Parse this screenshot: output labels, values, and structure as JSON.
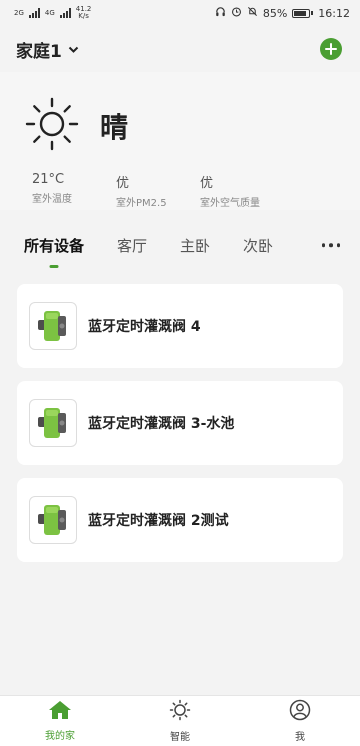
{
  "status_bar": {
    "network1": "2G",
    "network2": "4G",
    "speed_value": "41.2",
    "speed_unit": "K/s",
    "battery": "85%",
    "time": "16:12",
    "battery_level": 0.85
  },
  "header": {
    "home_name": "家庭1",
    "add_icon": "plus-circle-icon"
  },
  "weather": {
    "icon": "sun-icon",
    "condition": "晴",
    "metrics": [
      {
        "value": "21°C",
        "label": "室外温度"
      },
      {
        "value": "优",
        "label": "室外PM2.5"
      },
      {
        "value": "优",
        "label": "室外空气质量"
      }
    ]
  },
  "tabs": [
    {
      "label": "所有设备",
      "active": true
    },
    {
      "label": "客厅"
    },
    {
      "label": "主卧"
    },
    {
      "label": "次卧"
    }
  ],
  "devices": [
    {
      "name": "蓝牙定时灌溉阀 4"
    },
    {
      "name": "蓝牙定时灌溉阀 3-水池"
    },
    {
      "name": "蓝牙定时灌溉阀 2测试"
    }
  ],
  "bottom_nav": [
    {
      "label": "我的家",
      "icon": "home-icon",
      "active": true
    },
    {
      "label": "智能",
      "icon": "sun-outline-icon"
    },
    {
      "label": "我",
      "icon": "user-icon"
    }
  ],
  "colors": {
    "accent": "#4a9e32",
    "background": "#f3f3f3",
    "device_green": "#7cc242"
  }
}
